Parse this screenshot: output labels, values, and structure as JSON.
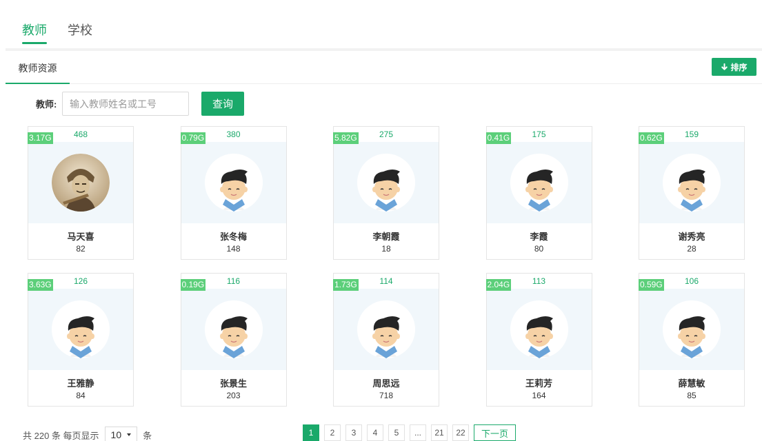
{
  "tabs": [
    {
      "label": "教师",
      "active": true
    },
    {
      "label": "学校",
      "active": false
    }
  ],
  "subheader": {
    "tab_label": "教师资源",
    "sort_label": "排序",
    "sort_icon": "arrow-down-icon"
  },
  "search": {
    "label": "教师:",
    "placeholder": "输入教师姓名或工号",
    "button_label": "查询"
  },
  "teachers": [
    {
      "size": "3.17G",
      "count": "468",
      "name": "马天喜",
      "num": "82",
      "avatar": "photo"
    },
    {
      "size": "0.79G",
      "count": "380",
      "name": "张冬梅",
      "num": "148",
      "avatar": "cartoon"
    },
    {
      "size": "5.82G",
      "count": "275",
      "name": "李朝霞",
      "num": "18",
      "avatar": "cartoon"
    },
    {
      "size": "0.41G",
      "count": "175",
      "name": "李霞",
      "num": "80",
      "avatar": "cartoon"
    },
    {
      "size": "0.62G",
      "count": "159",
      "name": "谢秀亮",
      "num": "28",
      "avatar": "cartoon"
    },
    {
      "size": "3.63G",
      "count": "126",
      "name": "王雅静",
      "num": "84",
      "avatar": "cartoon"
    },
    {
      "size": "0.19G",
      "count": "116",
      "name": "张景生",
      "num": "203",
      "avatar": "cartoon"
    },
    {
      "size": "1.73G",
      "count": "114",
      "name": "周思远",
      "num": "718",
      "avatar": "cartoon"
    },
    {
      "size": "2.04G",
      "count": "113",
      "name": "王莉芳",
      "num": "164",
      "avatar": "cartoon"
    },
    {
      "size": "0.59G",
      "count": "106",
      "name": "薛慧敏",
      "num": "85",
      "avatar": "cartoon"
    }
  ],
  "footer": {
    "total_prefix": "共 220 条 每页显示",
    "page_size": "10",
    "suffix": "条",
    "pages": [
      "1",
      "2",
      "3",
      "4",
      "5",
      "...",
      "21",
      "22"
    ],
    "current_page": "1",
    "next_label": "下一页"
  },
  "colors": {
    "accent": "#1aa96a",
    "badge": "#5ccf7a",
    "avatar_bg": "#f1f7fb"
  }
}
